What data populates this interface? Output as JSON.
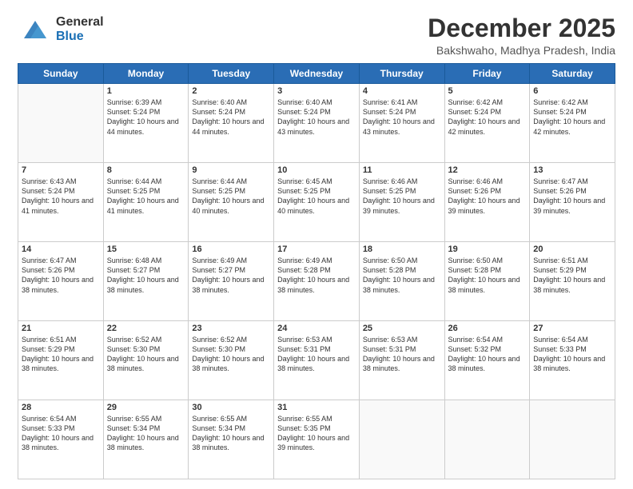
{
  "header": {
    "logo_general": "General",
    "logo_blue": "Blue",
    "month_year": "December 2025",
    "location": "Bakshwaho, Madhya Pradesh, India"
  },
  "days_of_week": [
    "Sunday",
    "Monday",
    "Tuesday",
    "Wednesday",
    "Thursday",
    "Friday",
    "Saturday"
  ],
  "weeks": [
    [
      {
        "day": "",
        "info": ""
      },
      {
        "day": "1",
        "info": "Sunrise: 6:39 AM\nSunset: 5:24 PM\nDaylight: 10 hours and 44 minutes."
      },
      {
        "day": "2",
        "info": "Sunrise: 6:40 AM\nSunset: 5:24 PM\nDaylight: 10 hours and 44 minutes."
      },
      {
        "day": "3",
        "info": "Sunrise: 6:40 AM\nSunset: 5:24 PM\nDaylight: 10 hours and 43 minutes."
      },
      {
        "day": "4",
        "info": "Sunrise: 6:41 AM\nSunset: 5:24 PM\nDaylight: 10 hours and 43 minutes."
      },
      {
        "day": "5",
        "info": "Sunrise: 6:42 AM\nSunset: 5:24 PM\nDaylight: 10 hours and 42 minutes."
      },
      {
        "day": "6",
        "info": "Sunrise: 6:42 AM\nSunset: 5:24 PM\nDaylight: 10 hours and 42 minutes."
      }
    ],
    [
      {
        "day": "7",
        "info": "Sunrise: 6:43 AM\nSunset: 5:24 PM\nDaylight: 10 hours and 41 minutes."
      },
      {
        "day": "8",
        "info": "Sunrise: 6:44 AM\nSunset: 5:25 PM\nDaylight: 10 hours and 41 minutes."
      },
      {
        "day": "9",
        "info": "Sunrise: 6:44 AM\nSunset: 5:25 PM\nDaylight: 10 hours and 40 minutes."
      },
      {
        "day": "10",
        "info": "Sunrise: 6:45 AM\nSunset: 5:25 PM\nDaylight: 10 hours and 40 minutes."
      },
      {
        "day": "11",
        "info": "Sunrise: 6:46 AM\nSunset: 5:25 PM\nDaylight: 10 hours and 39 minutes."
      },
      {
        "day": "12",
        "info": "Sunrise: 6:46 AM\nSunset: 5:26 PM\nDaylight: 10 hours and 39 minutes."
      },
      {
        "day": "13",
        "info": "Sunrise: 6:47 AM\nSunset: 5:26 PM\nDaylight: 10 hours and 39 minutes."
      }
    ],
    [
      {
        "day": "14",
        "info": "Sunrise: 6:47 AM\nSunset: 5:26 PM\nDaylight: 10 hours and 38 minutes."
      },
      {
        "day": "15",
        "info": "Sunrise: 6:48 AM\nSunset: 5:27 PM\nDaylight: 10 hours and 38 minutes."
      },
      {
        "day": "16",
        "info": "Sunrise: 6:49 AM\nSunset: 5:27 PM\nDaylight: 10 hours and 38 minutes."
      },
      {
        "day": "17",
        "info": "Sunrise: 6:49 AM\nSunset: 5:28 PM\nDaylight: 10 hours and 38 minutes."
      },
      {
        "day": "18",
        "info": "Sunrise: 6:50 AM\nSunset: 5:28 PM\nDaylight: 10 hours and 38 minutes."
      },
      {
        "day": "19",
        "info": "Sunrise: 6:50 AM\nSunset: 5:28 PM\nDaylight: 10 hours and 38 minutes."
      },
      {
        "day": "20",
        "info": "Sunrise: 6:51 AM\nSunset: 5:29 PM\nDaylight: 10 hours and 38 minutes."
      }
    ],
    [
      {
        "day": "21",
        "info": "Sunrise: 6:51 AM\nSunset: 5:29 PM\nDaylight: 10 hours and 38 minutes."
      },
      {
        "day": "22",
        "info": "Sunrise: 6:52 AM\nSunset: 5:30 PM\nDaylight: 10 hours and 38 minutes."
      },
      {
        "day": "23",
        "info": "Sunrise: 6:52 AM\nSunset: 5:30 PM\nDaylight: 10 hours and 38 minutes."
      },
      {
        "day": "24",
        "info": "Sunrise: 6:53 AM\nSunset: 5:31 PM\nDaylight: 10 hours and 38 minutes."
      },
      {
        "day": "25",
        "info": "Sunrise: 6:53 AM\nSunset: 5:31 PM\nDaylight: 10 hours and 38 minutes."
      },
      {
        "day": "26",
        "info": "Sunrise: 6:54 AM\nSunset: 5:32 PM\nDaylight: 10 hours and 38 minutes."
      },
      {
        "day": "27",
        "info": "Sunrise: 6:54 AM\nSunset: 5:33 PM\nDaylight: 10 hours and 38 minutes."
      }
    ],
    [
      {
        "day": "28",
        "info": "Sunrise: 6:54 AM\nSunset: 5:33 PM\nDaylight: 10 hours and 38 minutes."
      },
      {
        "day": "29",
        "info": "Sunrise: 6:55 AM\nSunset: 5:34 PM\nDaylight: 10 hours and 38 minutes."
      },
      {
        "day": "30",
        "info": "Sunrise: 6:55 AM\nSunset: 5:34 PM\nDaylight: 10 hours and 38 minutes."
      },
      {
        "day": "31",
        "info": "Sunrise: 6:55 AM\nSunset: 5:35 PM\nDaylight: 10 hours and 39 minutes."
      },
      {
        "day": "",
        "info": ""
      },
      {
        "day": "",
        "info": ""
      },
      {
        "day": "",
        "info": ""
      }
    ]
  ]
}
